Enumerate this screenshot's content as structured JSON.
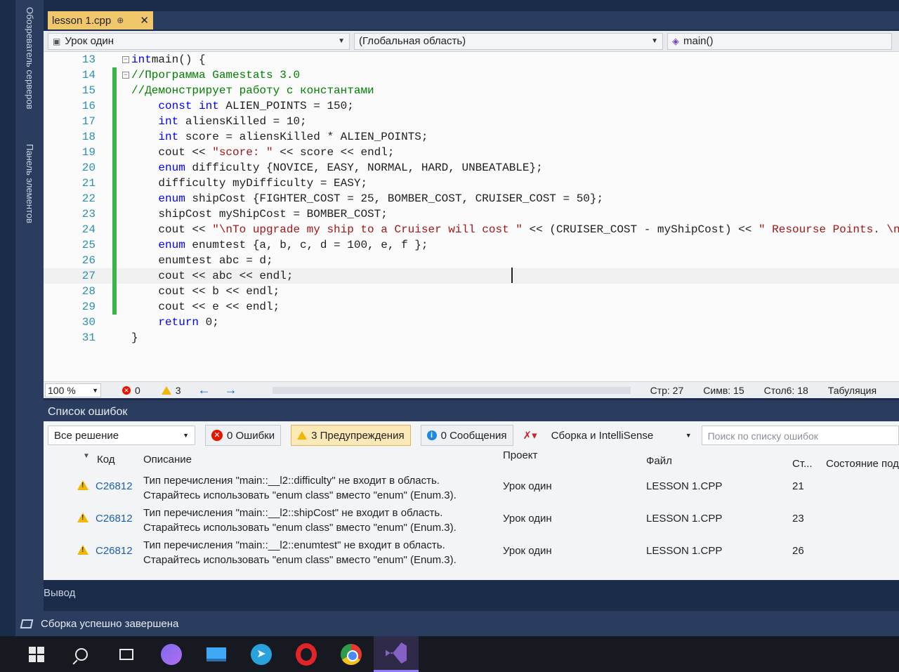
{
  "sidebar": {
    "server_explorer": "Обозреватель серверов",
    "toolbox": "Панель элементов"
  },
  "document_tab": {
    "title": "lesson 1.cpp",
    "pin": "⊕",
    "close": "✕"
  },
  "nav_bar": {
    "project": "Урок один",
    "scope": "(Глобальная область)",
    "member": "main()"
  },
  "editor": {
    "lines": [
      {
        "n": "13",
        "fold": "−",
        "changed": false,
        "segs": [
          [
            "kw",
            "int"
          ],
          [
            "",
            "main() {"
          ]
        ]
      },
      {
        "n": "14",
        "fold": "−",
        "changed": true,
        "segs": [
          [
            "cmt",
            "//Программа Gamestats 3.0"
          ]
        ]
      },
      {
        "n": "15",
        "fold": "",
        "changed": true,
        "segs": [
          [
            "cmt",
            "//Демонстрирует работу с константами"
          ]
        ]
      },
      {
        "n": "16",
        "fold": "",
        "changed": true,
        "segs": [
          [
            "",
            "    "
          ],
          [
            "kw",
            "const int"
          ],
          [
            "",
            " ALIEN_POINTS = 150;"
          ]
        ]
      },
      {
        "n": "17",
        "fold": "",
        "changed": true,
        "segs": [
          [
            "",
            "    "
          ],
          [
            "kw",
            "int"
          ],
          [
            "",
            " aliensKilled = 10;"
          ]
        ]
      },
      {
        "n": "18",
        "fold": "",
        "changed": true,
        "segs": [
          [
            "",
            "    "
          ],
          [
            "kw",
            "int"
          ],
          [
            "",
            " score = aliensKilled * ALIEN_POINTS;"
          ]
        ]
      },
      {
        "n": "19",
        "fold": "",
        "changed": true,
        "segs": [
          [
            "",
            "    cout << "
          ],
          [
            "str",
            "\"score: \""
          ],
          [
            "",
            " << score << endl;"
          ]
        ]
      },
      {
        "n": "20",
        "fold": "",
        "changed": true,
        "segs": [
          [
            "",
            "    "
          ],
          [
            "kw",
            "enum"
          ],
          [
            "",
            " difficulty {NOVICE, EASY, NORMAL, HARD, UNBEATABLE};"
          ]
        ]
      },
      {
        "n": "21",
        "fold": "",
        "changed": true,
        "segs": [
          [
            "",
            "    difficulty myDifficulty = EASY;"
          ]
        ]
      },
      {
        "n": "22",
        "fold": "",
        "changed": true,
        "segs": [
          [
            "",
            "    "
          ],
          [
            "kw",
            "enum"
          ],
          [
            "",
            " shipCost {FIGHTER_COST = 25, BOMBER_COST, CRUISER_COST = 50};"
          ]
        ]
      },
      {
        "n": "23",
        "fold": "",
        "changed": true,
        "segs": [
          [
            "",
            "    shipCost myShipCost = BOMBER_COST;"
          ]
        ]
      },
      {
        "n": "24",
        "fold": "",
        "changed": true,
        "segs": [
          [
            "",
            "    cout << "
          ],
          [
            "str",
            "\"\\nTo upgrade my ship to a Cruiser will cost \""
          ],
          [
            "",
            " << (CRUISER_COST - myShipCost) << "
          ],
          [
            "str",
            "\" Resourse Points. \\n"
          ]
        ]
      },
      {
        "n": "25",
        "fold": "",
        "changed": true,
        "segs": [
          [
            "",
            "    "
          ],
          [
            "kw",
            "enum"
          ],
          [
            "",
            " enumtest {a, b, c, d = 100, e, f };"
          ]
        ]
      },
      {
        "n": "26",
        "fold": "",
        "changed": true,
        "segs": [
          [
            "",
            "    enumtest abc = d;"
          ]
        ]
      },
      {
        "n": "27",
        "fold": "",
        "changed": true,
        "segs": [
          [
            "",
            "    cout << abc << endl;"
          ]
        ]
      },
      {
        "n": "28",
        "fold": "",
        "changed": true,
        "segs": [
          [
            "",
            "    cout << b << endl;"
          ]
        ]
      },
      {
        "n": "29",
        "fold": "",
        "changed": true,
        "segs": [
          [
            "",
            "    cout << e << endl;"
          ]
        ]
      },
      {
        "n": "30",
        "fold": "",
        "changed": false,
        "segs": [
          [
            "",
            "    "
          ],
          [
            "kw",
            "return"
          ],
          [
            "",
            " 0;"
          ]
        ]
      },
      {
        "n": "31",
        "fold": "",
        "changed": false,
        "segs": [
          [
            "",
            "}"
          ]
        ]
      }
    ],
    "current_line": "27"
  },
  "editor_status": {
    "zoom": "100 %",
    "errors": "0",
    "warnings": "3",
    "row": "Стр: 27",
    "char": "Симв: 15",
    "col": "Стол6: 18",
    "tabs": "Табуляция"
  },
  "error_list": {
    "title": "Список ошибок",
    "scope": "Все решение",
    "errors_btn": "0 Ошибки",
    "warnings_btn": "3 Предупреждения",
    "messages_btn": "0 Сообщения",
    "build_filter": "Сборка и IntelliSense",
    "search_placeholder": "Поиск по списку ошибок",
    "columns": {
      "code": "Код",
      "description": "Описание",
      "project": "Проект",
      "file": "Файл",
      "line": "Ст...",
      "state": "Состояние подавления"
    },
    "rows": [
      {
        "code": "C26812",
        "desc1": "Тип перечисления \"main::__l2::difficulty\" не входит в область.",
        "desc2": "Старайтесь использовать \"enum class\" вместо \"enum\" (Enum.3).",
        "project": "Урок один",
        "file": "LESSON 1.CPP",
        "line": "21"
      },
      {
        "code": "C26812",
        "desc1": "Тип перечисления \"main::__l2::shipCost\" не входит в область.",
        "desc2": "Старайтесь использовать \"enum class\" вместо \"enum\" (Enum.3).",
        "project": "Урок один",
        "file": "LESSON 1.CPP",
        "line": "23"
      },
      {
        "code": "C26812",
        "desc1": "Тип перечисления \"main::__l2::enumtest\" не входит в область.",
        "desc2": "Старайтесь использовать \"enum class\" вместо \"enum\" (Enum.3).",
        "project": "Урок один",
        "file": "LESSON 1.CPP",
        "line": "26"
      }
    ]
  },
  "output_tab": "Вывод",
  "status_bar": {
    "text": "Сборка успешно завершена"
  }
}
